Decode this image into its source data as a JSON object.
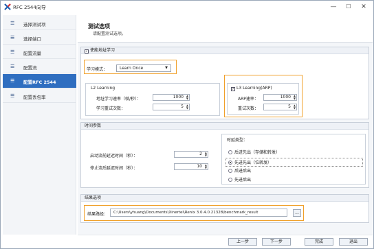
{
  "window": {
    "title": "RFC 2544向导",
    "minimize": "—",
    "maximize": "☐",
    "close": "✕"
  },
  "sidebar": {
    "items": [
      {
        "label": "选择测试项"
      },
      {
        "label": "选择端口"
      },
      {
        "label": "配置流量"
      },
      {
        "label": "配置流"
      },
      {
        "label": "配置RFC 2544"
      },
      {
        "label": "配置丢包率"
      }
    ]
  },
  "header": {
    "title": "测试选项",
    "subtitle": "请配置测试选项。"
  },
  "learning": {
    "enable_label": "使能地址学习",
    "mode_label": "学习模式：",
    "mode_value": "Learn Once",
    "l2": {
      "title": "L2 Learning",
      "rate_label": "地址学习速率（帧/秒）：",
      "rate_value": "1000",
      "retries_label": "学习重试次数：",
      "retries_value": "5"
    },
    "l3": {
      "title": "L3 Learning(ARP)",
      "arp_rate_label": "ARP速率：",
      "arp_rate_value": "1000",
      "retries_label": "重试次数：",
      "retries_value": "5"
    }
  },
  "timing": {
    "title": "时间参数",
    "start_delay_label": "启动流前延迟时间（秒）：",
    "start_delay_value": "2",
    "stop_delay_label": "停止流后延迟时间（秒）：",
    "stop_delay_value": "10",
    "latency": {
      "title": "时延类型：",
      "options": [
        {
          "label": "后进先出（存储和转发）",
          "selected": false
        },
        {
          "label": "先进先出（位转发）",
          "selected": true
        },
        {
          "label": "后进后出",
          "selected": false
        },
        {
          "label": "先进后出",
          "selected": false
        }
      ]
    }
  },
  "result": {
    "title": "结果选项",
    "path_label": "结果路径：",
    "path_value": "C:\\Users\\yhuang\\Documents\\Xinertel\\Renix 3.0.4.0.21328\\benchmark_result",
    "browse_label": "..."
  },
  "footer": {
    "prev": "上一步",
    "next": "下一步",
    "finish": "完成",
    "exit": "退出"
  },
  "colors": {
    "accent": "#2f6ec0",
    "highlight": "#f0a02a"
  }
}
